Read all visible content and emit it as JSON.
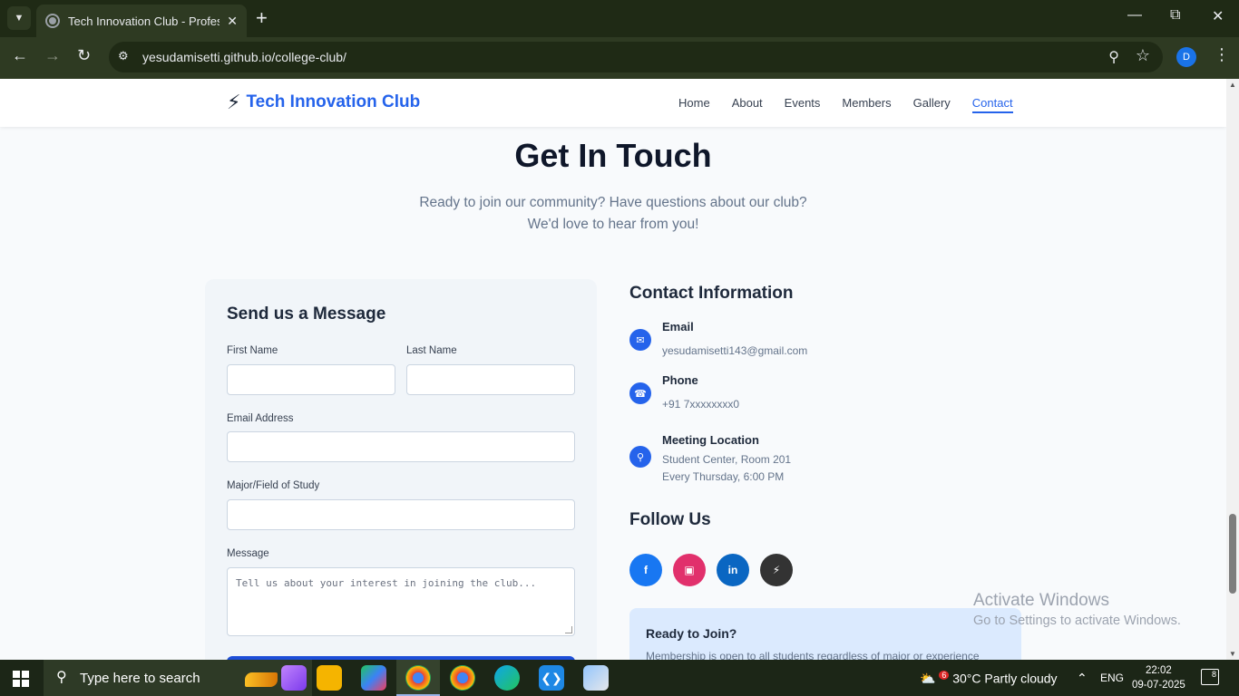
{
  "browser": {
    "tab_title": "Tech Innovation Club - Professio",
    "url": "yesudamisetti.github.io/college-club/",
    "profile_initial": "D"
  },
  "site": {
    "logo_text": "Tech Innovation Club",
    "nav": [
      "Home",
      "About",
      "Events",
      "Members",
      "Gallery",
      "Contact"
    ],
    "active_nav": "Contact",
    "accent_color": "#2563eb"
  },
  "contact": {
    "title": "Get In Touch",
    "subtitle": "Ready to join our community? Have questions about our club? We'd love to hear from you!"
  },
  "form": {
    "title": "Send us a Message",
    "first_name_label": "First Name",
    "last_name_label": "Last Name",
    "email_label": "Email Address",
    "major_label": "Major/Field of Study",
    "message_label": "Message",
    "message_placeholder": "Tell us about your interest in joining the club..."
  },
  "info": {
    "title": "Contact Information",
    "email_label": "Email",
    "email_value": "yesudamisetti143@gmail.com",
    "phone_label": "Phone",
    "phone_value": "+91 7xxxxxxxx0",
    "location_label": "Meeting Location",
    "location_line1": "Student Center, Room 201",
    "location_line2": "Every Thursday, 6:00 PM"
  },
  "follow": {
    "title": "Follow Us",
    "icons": [
      "facebook-icon",
      "instagram-icon",
      "linkedin-icon",
      "bolt-icon"
    ],
    "colors": [
      "#1877f2",
      "#e1306c",
      "#0a66c2",
      "#333333"
    ]
  },
  "join": {
    "title": "Ready to Join?",
    "text": "Membership is open to all students regardless of major or experience"
  },
  "watermark": {
    "line1": "Activate Windows",
    "line2": "Go to Settings to activate Windows."
  },
  "taskbar": {
    "search_placeholder": "Type here to search",
    "weather_badge": "6",
    "weather": "30°C  Partly cloudy",
    "lang": "ENG",
    "time": "22:02",
    "date": "09-07-2025",
    "notifications": "8"
  }
}
